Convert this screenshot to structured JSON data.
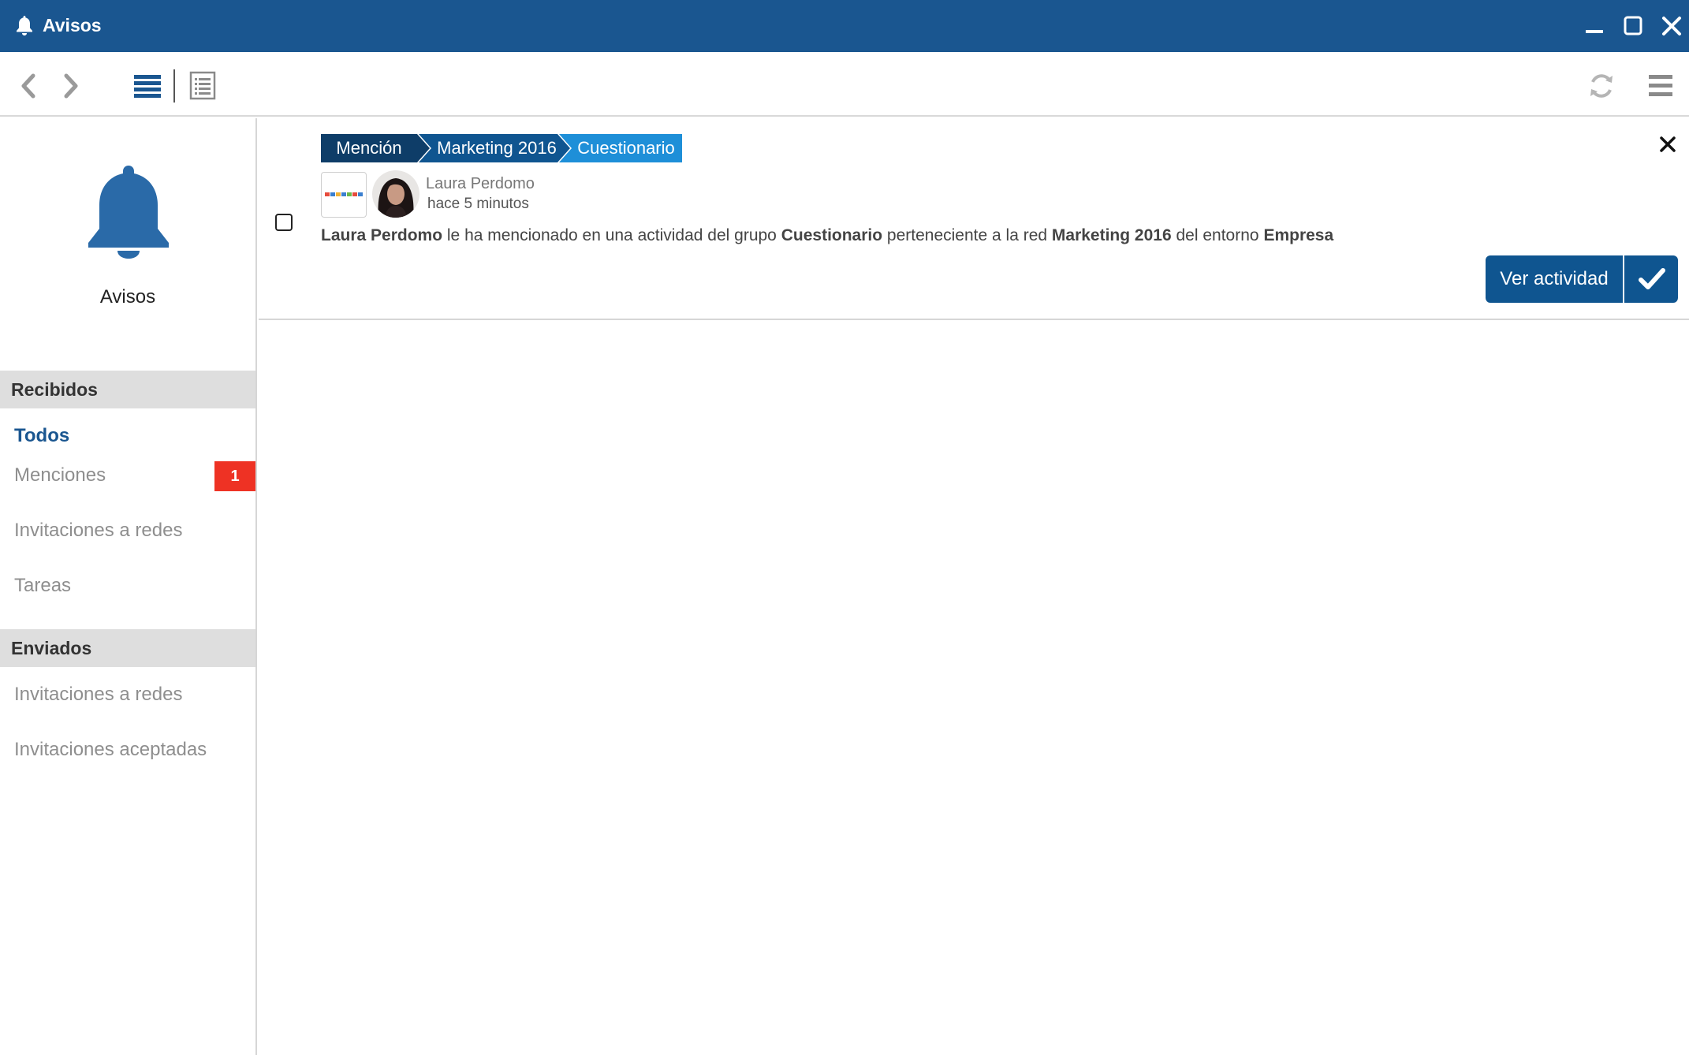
{
  "window": {
    "title": "Avisos",
    "controls": [
      "minimize-icon",
      "maximize-icon",
      "close-icon"
    ]
  },
  "toolbar": {
    "icons": [
      "chevron-left-icon",
      "chevron-right-icon",
      "list-view-icon",
      "detail-view-icon",
      "refresh-icon",
      "menu-icon"
    ]
  },
  "sidebar": {
    "title": "Avisos",
    "icon": "bell-icon",
    "received": {
      "heading": "Recibidos",
      "items": [
        {
          "label": "Todos",
          "active": true
        },
        {
          "label": "Menciones",
          "badge": "1"
        },
        {
          "label": "Invitaciones a redes"
        },
        {
          "label": "Tareas"
        }
      ]
    },
    "sent": {
      "heading": "Enviados",
      "items": [
        {
          "label": "Invitaciones a redes"
        },
        {
          "label": "Invitaciones aceptadas"
        }
      ]
    }
  },
  "notification": {
    "breadcrumbs": [
      "Mención",
      "Marketing 2016",
      "Cuestionario"
    ],
    "author": "Laura Perdomo",
    "time": "hace 5 minutos",
    "message": {
      "author": "Laura Perdomo",
      "text1": "le ha mencionado en una actividad del grupo",
      "group": "Cuestionario",
      "text2": "perteneciente a la red",
      "network": "Marketing 2016",
      "text3": "del entorno",
      "environment": "Empresa"
    },
    "view_button": "Ver actividad"
  },
  "colors": {
    "titlebar": "#1a5690",
    "crumb1": "#0e3d68",
    "crumb2": "#0f5590",
    "crumb3": "#1e8fd8",
    "badge": "#ee3224",
    "button": "#0f5590"
  }
}
